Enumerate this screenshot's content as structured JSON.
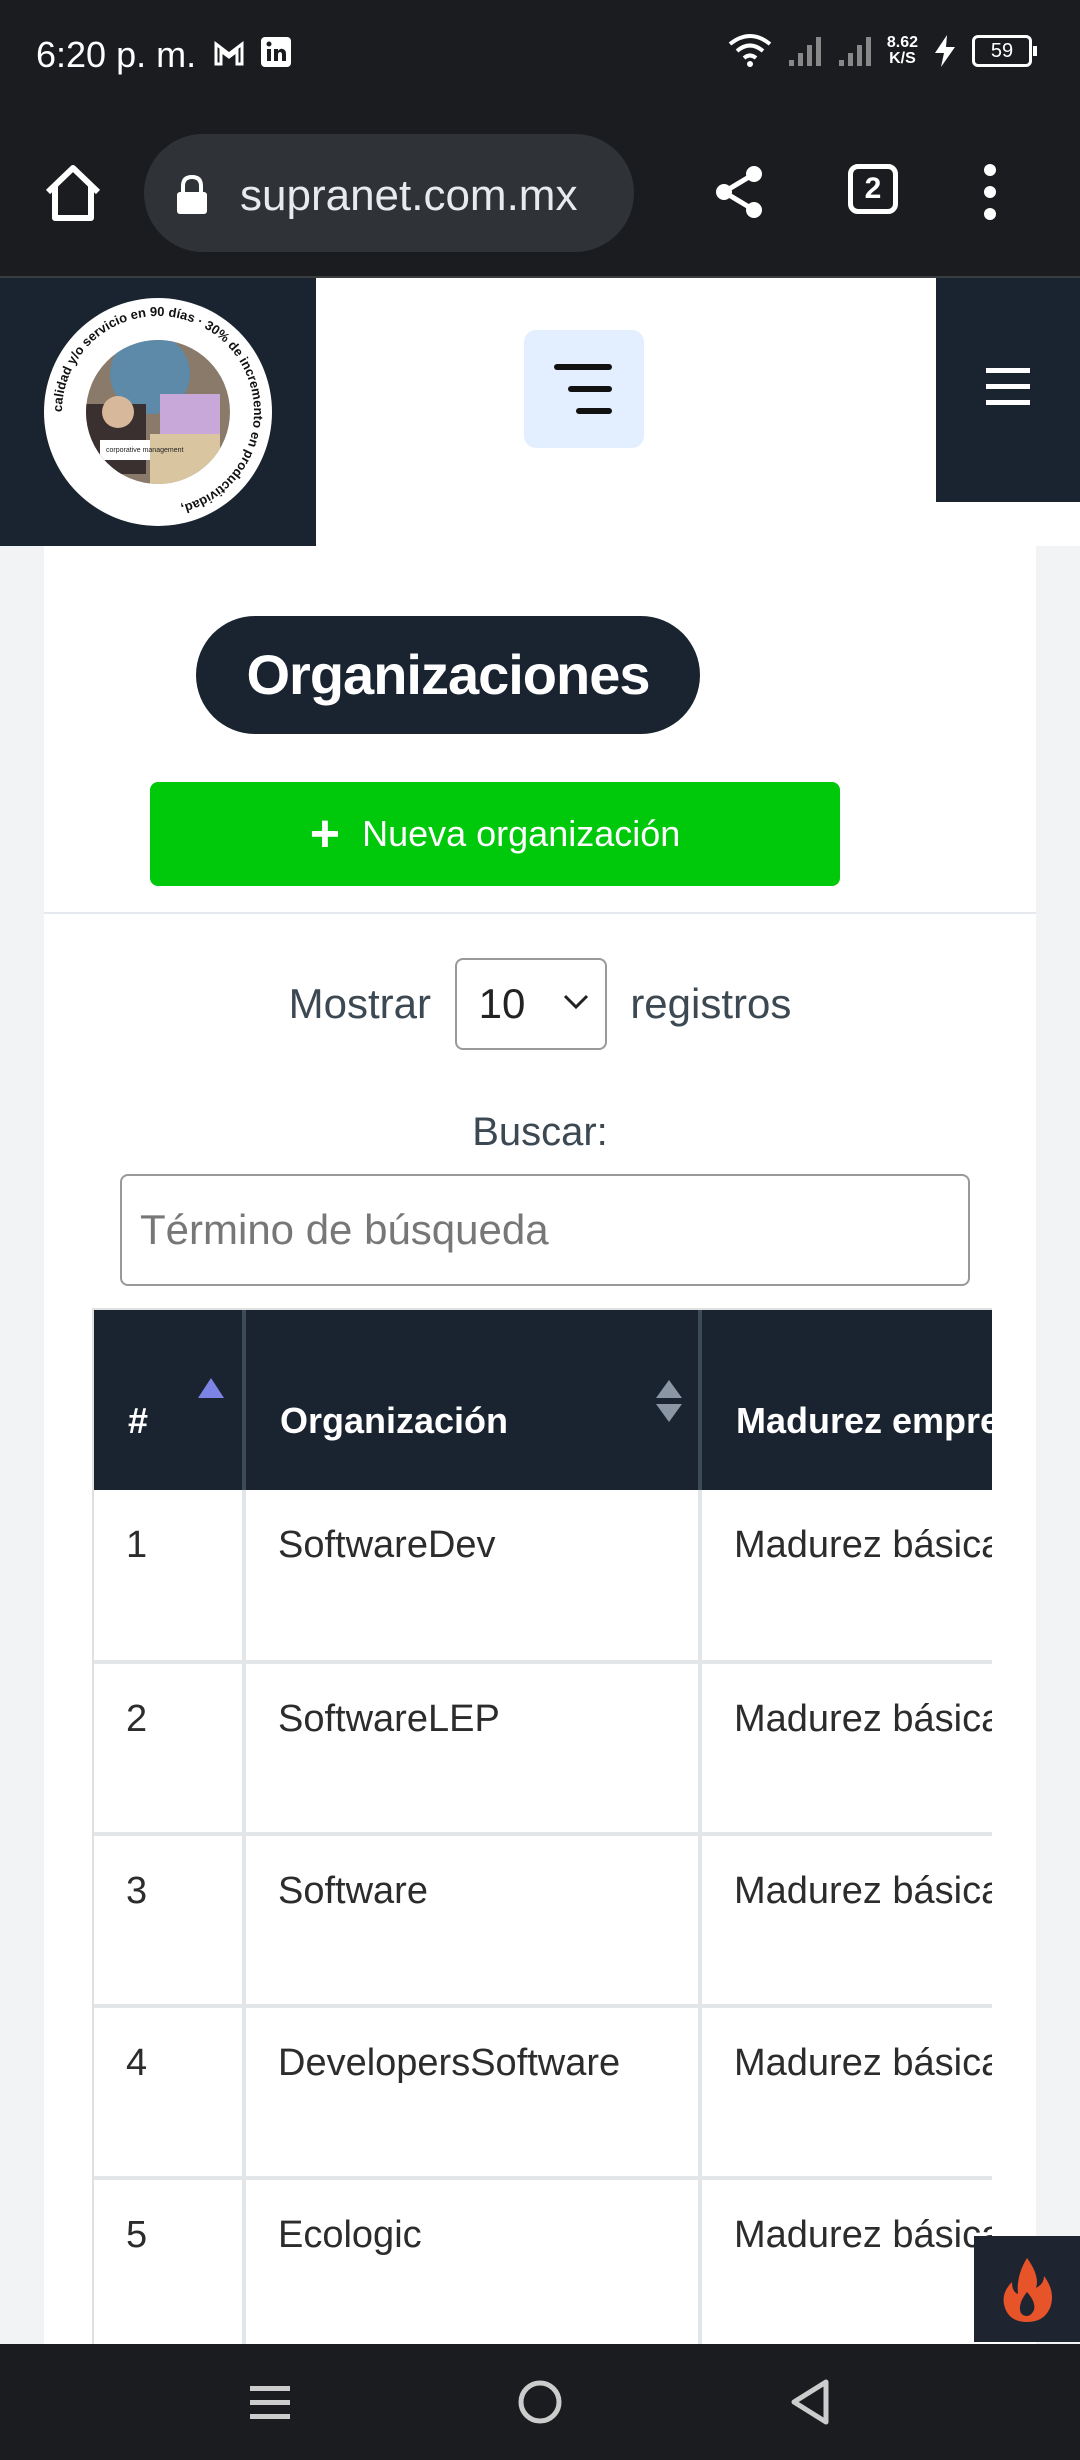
{
  "status_bar": {
    "time": "6:20 p. m.",
    "network_speed": "8.62",
    "network_speed_unit": "K/S",
    "battery": "59",
    "icons": [
      "gmail-icon",
      "linkedin-icon",
      "wifi-icon",
      "signal-icon",
      "signal-icon",
      "charging-icon",
      "battery-icon"
    ]
  },
  "browser": {
    "url": "supranet.com.mx",
    "tab_count": "2"
  },
  "page": {
    "title": "Organizaciones",
    "new_button_label": "Nueva organización",
    "show_label": "Mostrar",
    "show_value": "10",
    "records_label": "registros",
    "search_label": "Buscar:",
    "search_placeholder": "Término de búsqueda"
  },
  "logo": {
    "ring_text": "calidad y/o servicio en 90 días · 30% de incremento en productividad,",
    "inner_text": "corporative management"
  },
  "table": {
    "columns": [
      "#",
      "Organización",
      "Madurez empresarial"
    ],
    "rows": [
      {
        "num": "1",
        "org": "SoftwareDev",
        "maturity": "Madurez básica"
      },
      {
        "num": "2",
        "org": "SoftwareLEP",
        "maturity": "Madurez básica"
      },
      {
        "num": "3",
        "org": "Software",
        "maturity": "Madurez básica"
      },
      {
        "num": "4",
        "org": "DevelopersSoftware",
        "maturity": "Madurez básica"
      },
      {
        "num": "5",
        "org": "Ecologic",
        "maturity": "Madurez básica"
      }
    ]
  },
  "colors": {
    "dark_navy": "#1a2430",
    "green": "#00c80b",
    "toggle_bg": "#e3efff",
    "sort_active": "#7c84e6"
  }
}
